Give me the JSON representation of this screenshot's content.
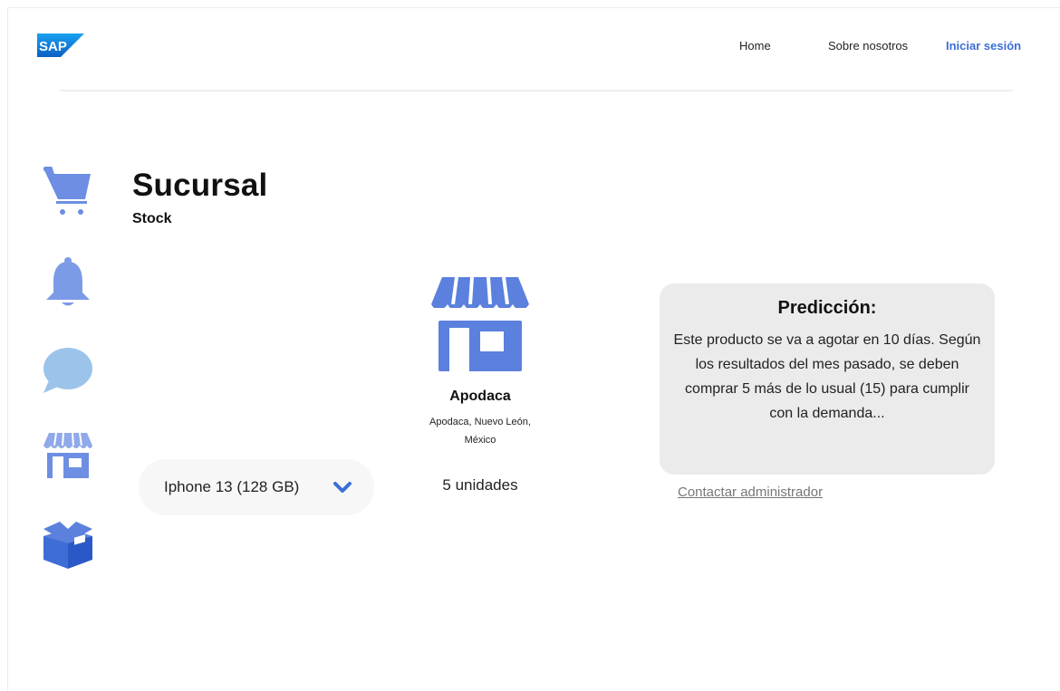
{
  "header": {
    "logo_text": "SAP",
    "nav": {
      "home": "Home",
      "about": "Sobre nosotros",
      "login": "Iniciar sesión"
    }
  },
  "sidebar": {
    "icons": [
      "cart-icon",
      "bell-icon",
      "chat-bubble-icon",
      "store-icon",
      "box-icon"
    ]
  },
  "page": {
    "title": "Sucursal",
    "subtitle": "Stock"
  },
  "product_select": {
    "selected": "Iphone 13 (128 GB)"
  },
  "branch": {
    "name": "Apodaca",
    "address_line1": "Apodaca, Nuevo León,",
    "address_line2": "México",
    "units": "5 unidades"
  },
  "prediction": {
    "title": "Predicción:",
    "text": "Este producto se va a agotar en 10 días. Según los resultados del mes pasado, se deben comprar 5 más de lo usual (15) para cumplir con la demanda..."
  },
  "contact_link": "Contactar administrador",
  "colors": {
    "accent": "#3b6fd6",
    "icon_blue": "#5b80dd",
    "icon_light": "#8fa9ea",
    "chat_blue": "#9cc3ea",
    "card_bg": "#ebebeb"
  }
}
